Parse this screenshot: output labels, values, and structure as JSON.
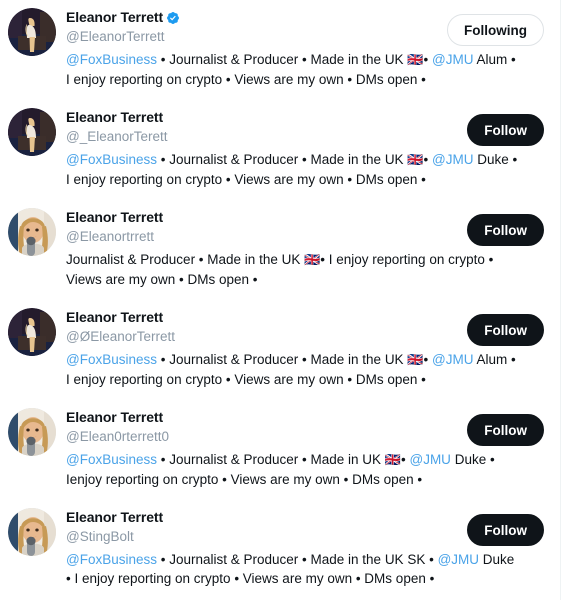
{
  "colors": {
    "background": "#ffffff",
    "text_primary": "#0f1419",
    "text_muted": "#8b98a5",
    "link": "#4aa3e8",
    "follow_button_bg": "#0f1419",
    "follow_button_text": "#ffffff",
    "following_button_border": "#dfe3e6",
    "verified_badge": "#1d9bf0",
    "panel_border": "#eff3f4"
  },
  "buttons": {
    "follow_label": "Follow",
    "following_label": "Following"
  },
  "users": [
    {
      "display_name": "Eleanor Terrett",
      "verified": true,
      "handle": "@EleanorTerrett",
      "avatar_style": "dark-stage",
      "button_label": "Following",
      "button_state": "following",
      "bio_parts": [
        {
          "type": "mention",
          "text": "@FoxBusiness"
        },
        {
          "type": "text",
          "text": " • Journalist & Producer • Made in the UK "
        },
        {
          "type": "flag",
          "text": "🇬🇧"
        },
        {
          "type": "text",
          "text": "• "
        },
        {
          "type": "mention",
          "text": "@JMU"
        },
        {
          "type": "text",
          "text": " Alum • I enjoy reporting on crypto • Views are my own • DMs open •"
        }
      ]
    },
    {
      "display_name": "Eleanor Terrett",
      "verified": false,
      "handle": "@_EleanorTerett",
      "avatar_style": "dark-stage",
      "button_label": "Follow",
      "button_state": "follow",
      "bio_parts": [
        {
          "type": "mention",
          "text": "@FoxBusiness"
        },
        {
          "type": "text",
          "text": " • Journalist & Producer • Made in the UK "
        },
        {
          "type": "flag",
          "text": "🇬🇧"
        },
        {
          "type": "text",
          "text": "• "
        },
        {
          "type": "mention",
          "text": "@JMU"
        },
        {
          "type": "text",
          "text": " Duke • I enjoy reporting on crypto • Views are my own • DMs open •"
        }
      ]
    },
    {
      "display_name": "Eleanor Terrett",
      "verified": false,
      "handle": "@Eleanortrrett",
      "avatar_style": "light-mic",
      "button_label": "Follow",
      "button_state": "follow",
      "bio_parts": [
        {
          "type": "text",
          "text": "Journalist & Producer • Made in the UK "
        },
        {
          "type": "flag",
          "text": "🇬🇧"
        },
        {
          "type": "text",
          "text": "• I enjoy reporting on crypto • Views are my own • DMs open •"
        }
      ]
    },
    {
      "display_name": "Eleanor Terrett",
      "verified": false,
      "handle": "@ØEleanorTerrett",
      "avatar_style": "dark-stage",
      "button_label": "Follow",
      "button_state": "follow",
      "bio_parts": [
        {
          "type": "mention",
          "text": "@FoxBusiness"
        },
        {
          "type": "text",
          "text": " • Journalist & Producer • Made in the UK "
        },
        {
          "type": "flag",
          "text": "🇬🇧"
        },
        {
          "type": "text",
          "text": "• "
        },
        {
          "type": "mention",
          "text": "@JMU"
        },
        {
          "type": "text",
          "text": " Alum • I enjoy reporting on crypto • Views are my own • DMs open •"
        }
      ]
    },
    {
      "display_name": "Eleanor Terrett",
      "verified": false,
      "handle": "@Elean0rterrett0",
      "avatar_style": "light-mic",
      "button_label": "Follow",
      "button_state": "follow",
      "bio_parts": [
        {
          "type": "mention",
          "text": "@FoxBusiness"
        },
        {
          "type": "text",
          "text": " • Journalist & Producer • Made in UK "
        },
        {
          "type": "flag",
          "text": "🇬🇧"
        },
        {
          "type": "text",
          "text": "• "
        },
        {
          "type": "mention",
          "text": "@JMU"
        },
        {
          "type": "text",
          "text": " Duke • Ienjoy reporting on crypto • Views are my own • DMs open •"
        }
      ]
    },
    {
      "display_name": "Eleanor Terrett",
      "verified": false,
      "handle": "@StingBolt",
      "avatar_style": "light-mic",
      "button_label": "Follow",
      "button_state": "follow",
      "bio_parts": [
        {
          "type": "mention",
          "text": "@FoxBusiness"
        },
        {
          "type": "text",
          "text": " • Journalist & Producer • Made in the UK SK • "
        },
        {
          "type": "mention",
          "text": "@JMU"
        },
        {
          "type": "text",
          "text": " Duke • I enjoy reporting on crypto • Views are my own • DMs open •"
        }
      ]
    }
  ]
}
